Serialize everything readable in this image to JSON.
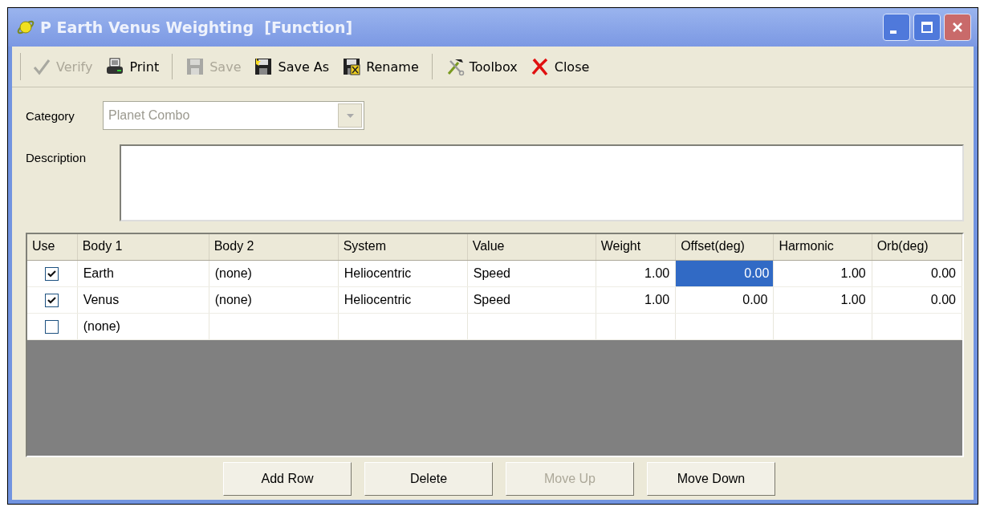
{
  "window": {
    "title": "P Earth Venus Weighting  [Function]"
  },
  "toolbar": [
    {
      "kind": "button",
      "label": "Verify",
      "disabled": true
    },
    {
      "kind": "button",
      "label": "Print",
      "disabled": false
    },
    {
      "kind": "separator"
    },
    {
      "kind": "button",
      "label": "Save",
      "disabled": true
    },
    {
      "kind": "button",
      "label": "Save As",
      "disabled": false
    },
    {
      "kind": "button",
      "label": "Rename",
      "disabled": false
    },
    {
      "kind": "separator"
    },
    {
      "kind": "button",
      "label": "Toolbox",
      "disabled": false
    },
    {
      "kind": "button",
      "label": "Close",
      "disabled": false
    }
  ],
  "category": {
    "label": "Category",
    "value": "Planet Combo",
    "disabled": true
  },
  "description": {
    "label": "Description"
  },
  "table": {
    "columns": [
      {
        "label": "Use",
        "kind": "check"
      },
      {
        "label": "Body 1",
        "kind": "text"
      },
      {
        "label": "Body 2",
        "kind": "text"
      },
      {
        "label": "System",
        "kind": "text"
      },
      {
        "label": "Value",
        "kind": "text"
      },
      {
        "label": "Weight",
        "kind": "number"
      },
      {
        "label": "Offset(deg)",
        "kind": "number"
      },
      {
        "label": "Harmonic",
        "kind": "number"
      },
      {
        "label": "Orb(deg)",
        "kind": "number"
      }
    ],
    "rows": [
      {
        "cells": [
          {
            "checked": true
          },
          {
            "text": "Earth",
            "selected": false
          },
          {
            "text": "(none)",
            "selected": false
          },
          {
            "text": "Heliocentric",
            "selected": false
          },
          {
            "text": "Speed",
            "selected": false
          },
          {
            "text": "1.00",
            "selected": false
          },
          {
            "text": "0.00",
            "selected": true
          },
          {
            "text": "1.00",
            "selected": false
          },
          {
            "text": "0.00",
            "selected": false
          }
        ]
      },
      {
        "cells": [
          {
            "checked": true
          },
          {
            "text": "Venus",
            "selected": false
          },
          {
            "text": "(none)",
            "selected": false
          },
          {
            "text": "Heliocentric",
            "selected": false
          },
          {
            "text": "Speed",
            "selected": false
          },
          {
            "text": "1.00",
            "selected": false
          },
          {
            "text": "0.00",
            "selected": false
          },
          {
            "text": "1.00",
            "selected": false
          },
          {
            "text": "0.00",
            "selected": false
          }
        ]
      },
      {
        "cells": [
          {
            "checked": false
          },
          {
            "text": "(none)",
            "selected": false
          }
        ]
      }
    ]
  },
  "buttons": [
    {
      "label": "Add Row",
      "disabled": false
    },
    {
      "label": "Delete",
      "disabled": false
    },
    {
      "label": "Move Up",
      "disabled": true
    },
    {
      "label": "Move Down",
      "disabled": false
    }
  ]
}
